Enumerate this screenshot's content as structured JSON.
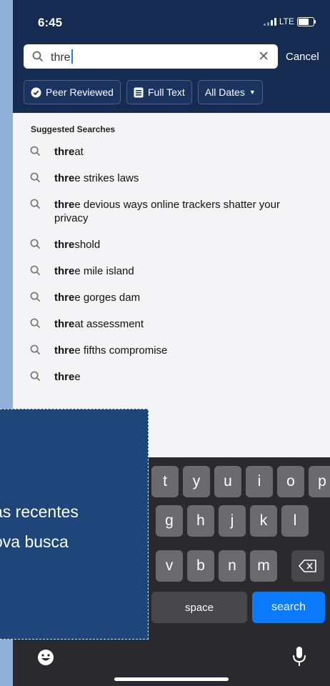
{
  "status": {
    "time": "6:45",
    "network": "LTE",
    "battery_level": 0.75
  },
  "search": {
    "query": "thre",
    "cancel_label": "Cancel"
  },
  "filters": [
    {
      "label": "Peer Reviewed",
      "icon": "check-badge-icon"
    },
    {
      "label": "Full Text",
      "icon": "document-icon"
    },
    {
      "label": "All Dates",
      "icon": "chevron-down-icon"
    }
  ],
  "suggestions": {
    "title": "Suggested Searches",
    "items": [
      {
        "bold": "thre",
        "rest": "at"
      },
      {
        "bold": "thre",
        "rest": "e strikes laws"
      },
      {
        "bold": "thre",
        "rest": "e devious ways online trackers shatter your privacy"
      },
      {
        "bold": "thre",
        "rest": "shold"
      },
      {
        "bold": "thre",
        "rest": "e mile island"
      },
      {
        "bold": "thre",
        "rest": "e gorges dam"
      },
      {
        "bold": "thre",
        "rest": "at assessment"
      },
      {
        "bold": "thre",
        "rest": "e fifths compromise"
      },
      {
        "bold": "thre",
        "rest": "e"
      }
    ]
  },
  "keyboard": {
    "row1": [
      "t",
      "y",
      "u",
      "i",
      "o",
      "p"
    ],
    "row2": [
      "g",
      "h",
      "j",
      "k",
      "l"
    ],
    "row3": [
      "v",
      "b",
      "n",
      "m"
    ],
    "space_label": "space",
    "search_label": "search"
  },
  "overlay": {
    "line1": "as recentes",
    "line2": "ova busca"
  }
}
